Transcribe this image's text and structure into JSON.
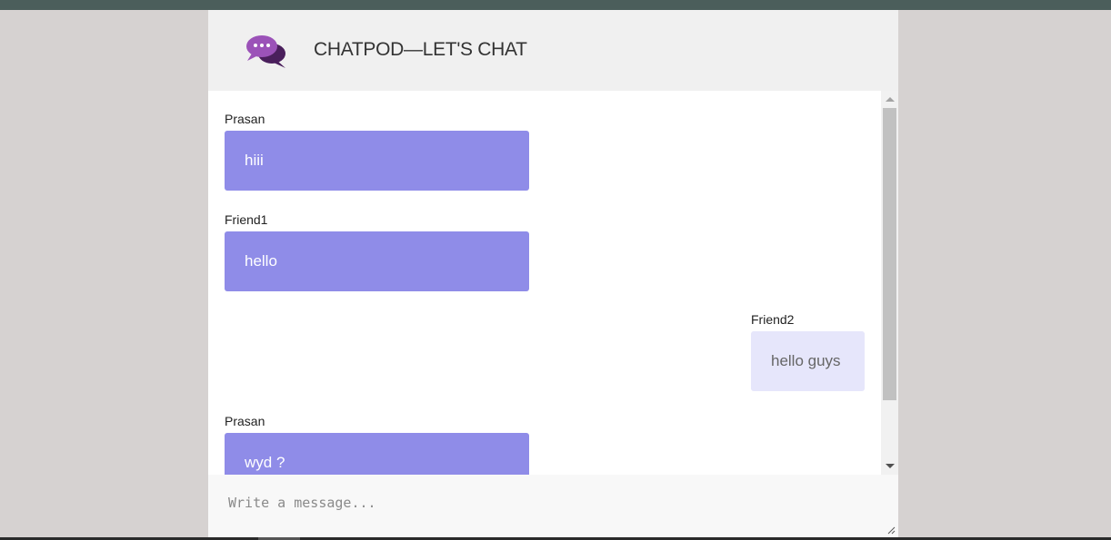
{
  "app": {
    "title": "CHATPOD—LET'S CHAT",
    "logo_icon": "chat-bubbles-icon",
    "accent_color": "#8f8ce8",
    "own_bubble_color": "#e6e6fb"
  },
  "messages": [
    {
      "sender": "Prasan",
      "text": "hiii",
      "side": "left"
    },
    {
      "sender": "Friend1",
      "text": "hello",
      "side": "left"
    },
    {
      "sender": "Friend2",
      "text": "hello guys",
      "side": "right"
    },
    {
      "sender": "Prasan",
      "text": "wyd ?",
      "side": "left"
    }
  ],
  "composer": {
    "placeholder": "Write a message...",
    "value": ""
  }
}
